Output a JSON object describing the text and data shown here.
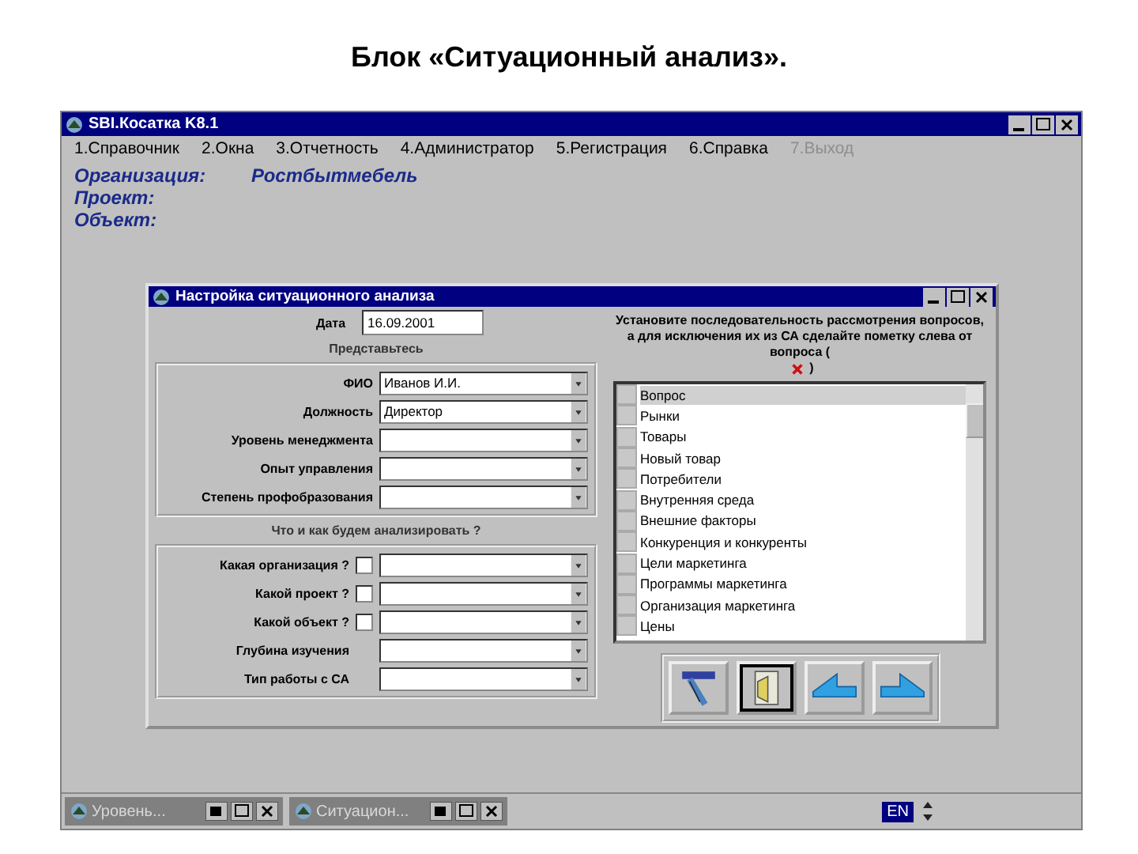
{
  "slide_title": "Блок «Ситуационный анализ».",
  "window": {
    "title": "SBI.Косатка K8.1"
  },
  "menu": [
    {
      "label": "1.Справочник",
      "disabled": false
    },
    {
      "label": "2.Окна",
      "disabled": false
    },
    {
      "label": "3.Отчетность",
      "disabled": false
    },
    {
      "label": "4.Администратор",
      "disabled": false
    },
    {
      "label": "5.Регистрация",
      "disabled": false
    },
    {
      "label": "6.Справка",
      "disabled": false
    },
    {
      "label": "7.Выход",
      "disabled": true
    }
  ],
  "info": [
    {
      "label": "Организация:",
      "value": "Ростбытмебель"
    },
    {
      "label": "Проект:"
    },
    {
      "label": "Объект:"
    }
  ],
  "dialog": {
    "title": "Настройка ситуационного анализа",
    "date_label": "Дата",
    "date_value": "16.09.2001",
    "intro_heading": "Представьтесь",
    "intro_fields": [
      {
        "label": "ФИО",
        "value": "Иванов И.И."
      },
      {
        "label": "Должность",
        "value": "Директор"
      },
      {
        "label": "Уровень менеджмента"
      },
      {
        "label": "Опыт управления"
      },
      {
        "label": "Степень профобразования"
      }
    ],
    "analysis_heading": "Что и как будем анализировать ?",
    "analysis_fields": [
      {
        "label": "Какая организация ?",
        "kind": "check",
        "checked": false
      },
      {
        "label": "Какой проект ?",
        "kind": "check",
        "checked": false
      },
      {
        "label": "Какой объект ?",
        "kind": "check",
        "checked": false
      },
      {
        "label": "Глубина изучения",
        "kind": "plain"
      },
      {
        "label": "Тип работы с СА",
        "kind": "plain"
      }
    ],
    "instruction": "Установите последовательность рассмотрения вопросов, а для исключения их из СА сделайте пометку слева от вопроса (",
    "instruction_close": ")",
    "list_header": "Вопрос",
    "list_items": [
      "Рынки",
      "Товары",
      "Новый товар",
      "Потребители",
      "Внутренняя среда",
      "Внешние факторы",
      "Конкуренция и конкуренты",
      "Цели маркетинга",
      "Программы маркетинга",
      "Организация маркетинга",
      "Цены"
    ],
    "tools": [
      {
        "kind": "ladder",
        "focused": false
      },
      {
        "kind": "door",
        "focused": true
      },
      {
        "kind": "back",
        "focused": false
      },
      {
        "kind": "forward",
        "focused": false
      }
    ]
  },
  "taskbar": [
    {
      "label": "Уровень..."
    },
    {
      "label": "Ситуацион..."
    }
  ],
  "language": "EN"
}
